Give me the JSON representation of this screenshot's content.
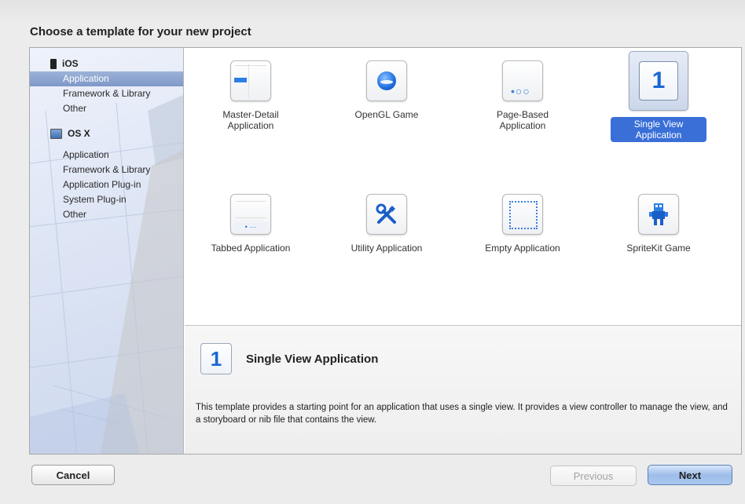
{
  "window": {
    "title": "Choose a template for your new project"
  },
  "sidebar": {
    "groups": [
      {
        "platform": "iOS",
        "items": [
          "Application",
          "Framework & Library",
          "Other"
        ],
        "selected_index": 0
      },
      {
        "platform": "OS X",
        "items": [
          "Application",
          "Framework & Library",
          "Application Plug-in",
          "System Plug-in",
          "Other"
        ]
      }
    ]
  },
  "templates": [
    {
      "label": "Master-Detail Application",
      "icon": "master-detail-icon"
    },
    {
      "label": "OpenGL Game",
      "icon": "opengl-game-icon"
    },
    {
      "label": "Page-Based Application",
      "icon": "page-based-icon",
      "glyph": "•○○"
    },
    {
      "label": "Single View Application",
      "icon": "single-view-icon",
      "glyph": "1",
      "selected": true
    },
    {
      "label": "Tabbed Application",
      "icon": "tabbed-icon",
      "glyph": "• ···"
    },
    {
      "label": "Utility Application",
      "icon": "utility-icon",
      "glyph": "✕"
    },
    {
      "label": "Empty Application",
      "icon": "empty-icon"
    },
    {
      "label": "SpriteKit Game",
      "icon": "spritekit-icon",
      "glyph": "♞"
    }
  ],
  "detail": {
    "glyph": "1",
    "title": "Single View Application",
    "description": "This template provides a starting point for an application that uses a single view. It provides a view controller to manage the view, and a storyboard or nib file that contains the view."
  },
  "buttons": {
    "cancel": "Cancel",
    "previous": "Previous",
    "next": "Next"
  },
  "colors": {
    "selection_blue": "#3a6fd8",
    "accent_icon_blue": "#1967d2",
    "sidebar_selected": "#8aa3cf"
  }
}
